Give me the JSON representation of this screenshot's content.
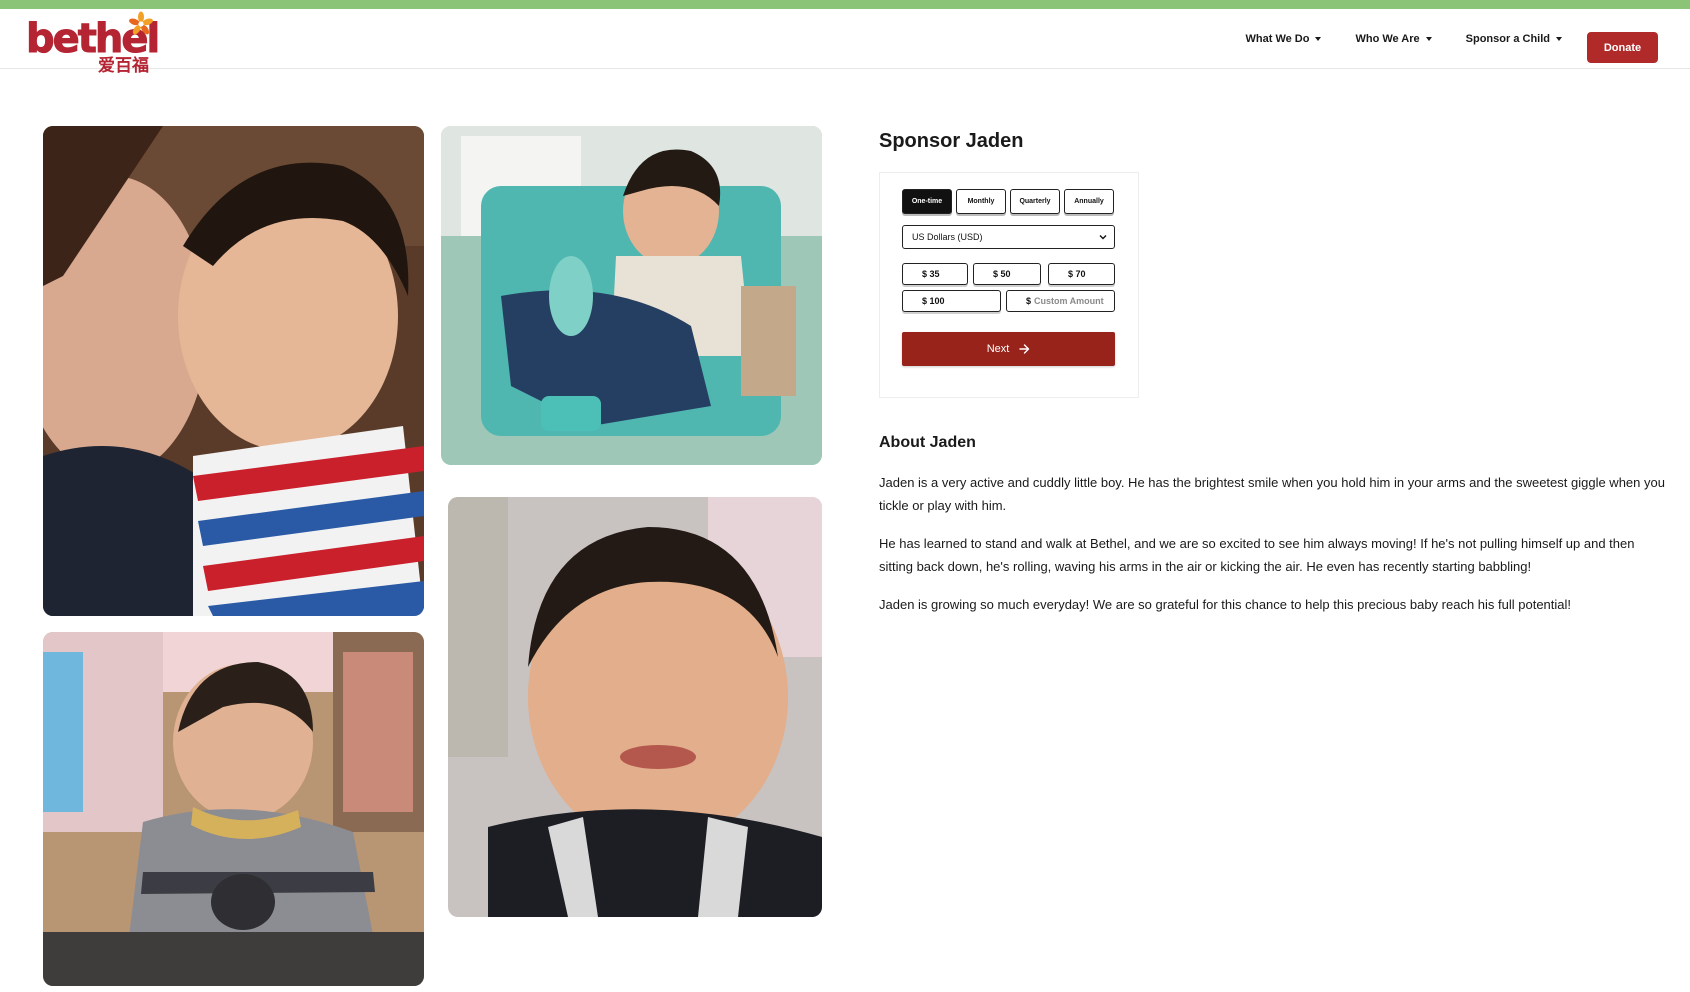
{
  "brand": {
    "logo_text": "bethel",
    "logo_cn": "爱百福",
    "top_strip_color": "#8bc477",
    "accent_color": "#b02a2a"
  },
  "nav": {
    "items": [
      {
        "label": "What We Do"
      },
      {
        "label": "Who We Are"
      },
      {
        "label": "Sponsor a Child"
      }
    ],
    "donate_label": "Donate"
  },
  "sponsor": {
    "title": "Sponsor Jaden",
    "frequencies": [
      {
        "label": "One-time",
        "active": true
      },
      {
        "label": "Monthly",
        "active": false
      },
      {
        "label": "Quarterly",
        "active": false
      },
      {
        "label": "Annually",
        "active": false
      }
    ],
    "currency": "US Dollars (USD)",
    "amounts": [
      "$ 35",
      "$ 50",
      "$ 70",
      "$ 100"
    ],
    "custom_currency": "$",
    "custom_placeholder": "Custom Amount",
    "next_label": "Next"
  },
  "about": {
    "title": "About Jaden",
    "paragraphs": [
      "Jaden is a very active and cuddly little boy. He has the brightest smile when you hold him in your arms and the sweetest giggle when you tickle or play with him.",
      "He has learned to stand and walk at Bethel, and we are so excited to see him always moving! If he's not pulling himself up and then sitting back down, he's rolling, waving his arms in the air or kicking the air. He even has recently starting babbling!",
      "Jaden is growing so much everyday! We are so grateful for this chance to help this precious baby reach his full potential!"
    ]
  },
  "photos": [
    {
      "name": "photo-jaden-hug"
    },
    {
      "name": "photo-jaden-chair"
    },
    {
      "name": "photo-jaden-sweater"
    },
    {
      "name": "photo-jaden-portrait"
    }
  ]
}
